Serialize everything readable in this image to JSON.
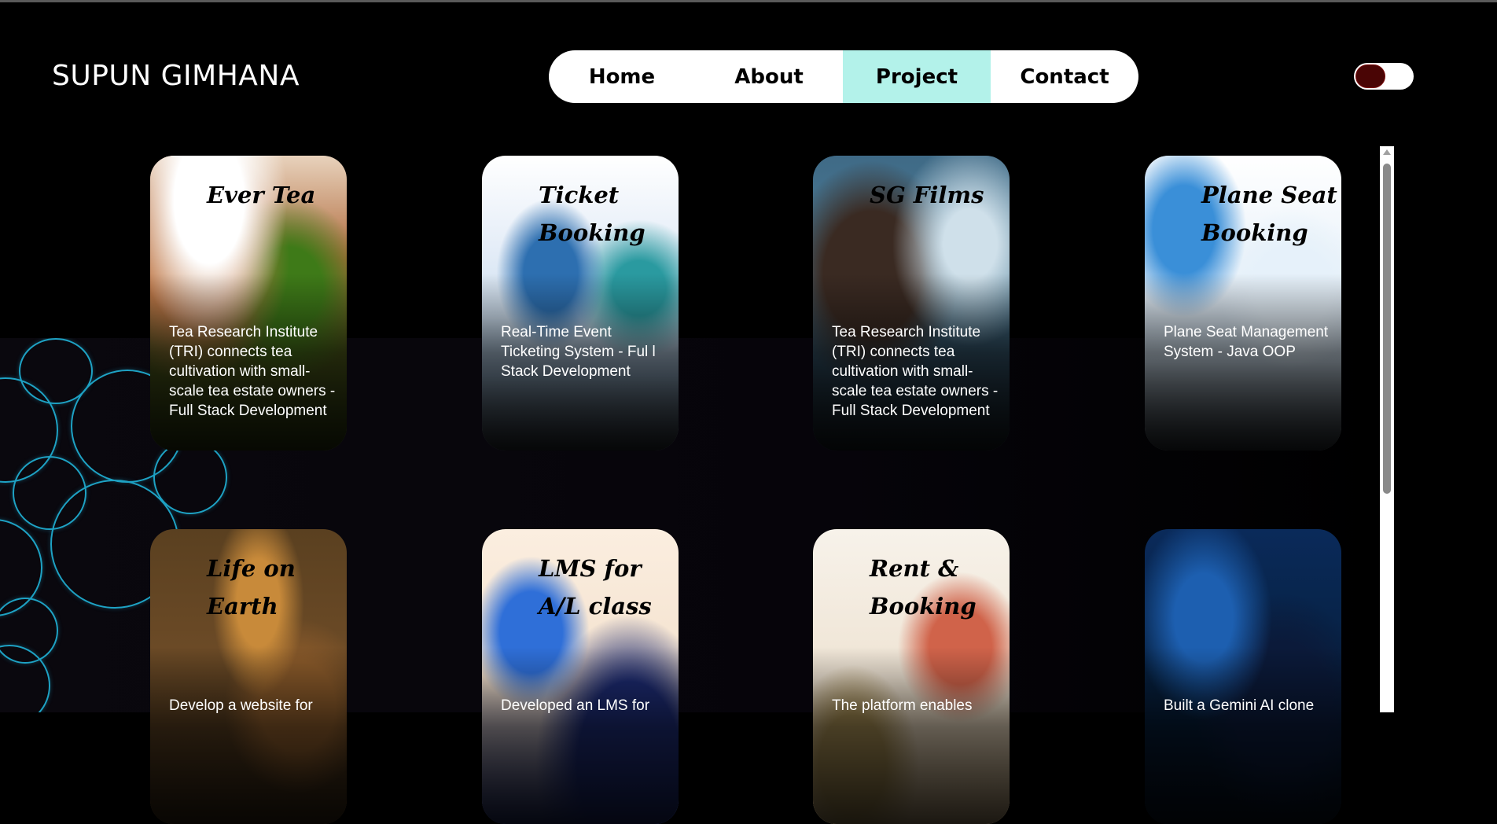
{
  "header": {
    "brand": "SUPUN GIMHANA",
    "nav": [
      {
        "label": "Home",
        "active": false
      },
      {
        "label": "About",
        "active": false
      },
      {
        "label": "Project",
        "active": true
      },
      {
        "label": "Contact",
        "active": false
      }
    ],
    "colors": {
      "nav_active_bg": "#b3f2ea",
      "toggle_knob": "#4a0505"
    }
  },
  "projects": [
    {
      "title": "Ever Tea",
      "description": "Tea Research Institute (TRI) connects tea cultivation with small-scale tea estate owners - Full Stack Development"
    },
    {
      "title": "Ticket Booking",
      "description": "Real-Time Event Ticketing System - Ful l Stack Development"
    },
    {
      "title": "SG Films",
      "description": "Tea Research Institute (TRI) connects tea cultivation with small-scale tea estate owners - Full Stack Development"
    },
    {
      "title": "Plane Seat Booking",
      "description": "Plane Seat Management System - Java OOP"
    },
    {
      "title": "Life on Earth",
      "description": "Develop a website for"
    },
    {
      "title": "LMS for A/L class",
      "description": "Developed an LMS for"
    },
    {
      "title": "Rent & Booking",
      "description": "The platform enables"
    },
    {
      "title": "",
      "description": "Built a Gemini AI clone"
    }
  ]
}
